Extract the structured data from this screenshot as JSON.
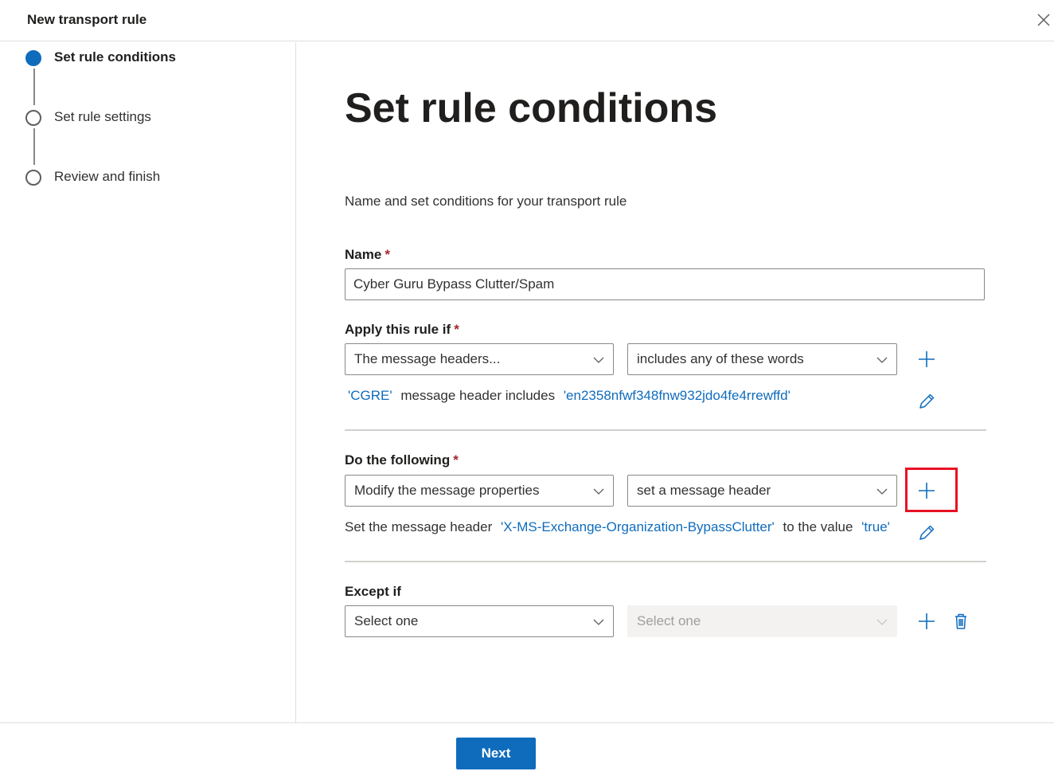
{
  "header": {
    "title": "New transport rule"
  },
  "steps": [
    {
      "label": "Set rule conditions",
      "state": "active"
    },
    {
      "label": "Set rule settings",
      "state": "pending"
    },
    {
      "label": "Review and finish",
      "state": "pending"
    }
  ],
  "main": {
    "title": "Set rule conditions",
    "description": "Name and set conditions for your transport rule",
    "name_field": {
      "label": "Name",
      "required_mark": "*",
      "value": "Cyber Guru Bypass Clutter/Spam"
    },
    "apply_if": {
      "label": "Apply this rule if",
      "required_mark": "*",
      "condition": "The message headers...",
      "operator": "includes any of these words",
      "summary": {
        "header_name": "'CGRE'",
        "text": "message header includes",
        "words": "'en2358nfwf348fnw932jdo4fe4rrewffd'"
      }
    },
    "do_following": {
      "label": "Do the following",
      "required_mark": "*",
      "action": "Modify the message properties",
      "sub_action": "set a message header",
      "summary": {
        "prefix": "Set the message header",
        "header_name": "'X-MS-Exchange-Organization-BypassClutter'",
        "middle": "to the value",
        "value": "'true'"
      }
    },
    "except_if": {
      "label": "Except if",
      "first": "Select one",
      "second": "Select one"
    }
  },
  "footer": {
    "next_label": "Next"
  },
  "colors": {
    "accent": "#0f6cbd",
    "highlight": "#e81123",
    "required": "#a4262c"
  }
}
